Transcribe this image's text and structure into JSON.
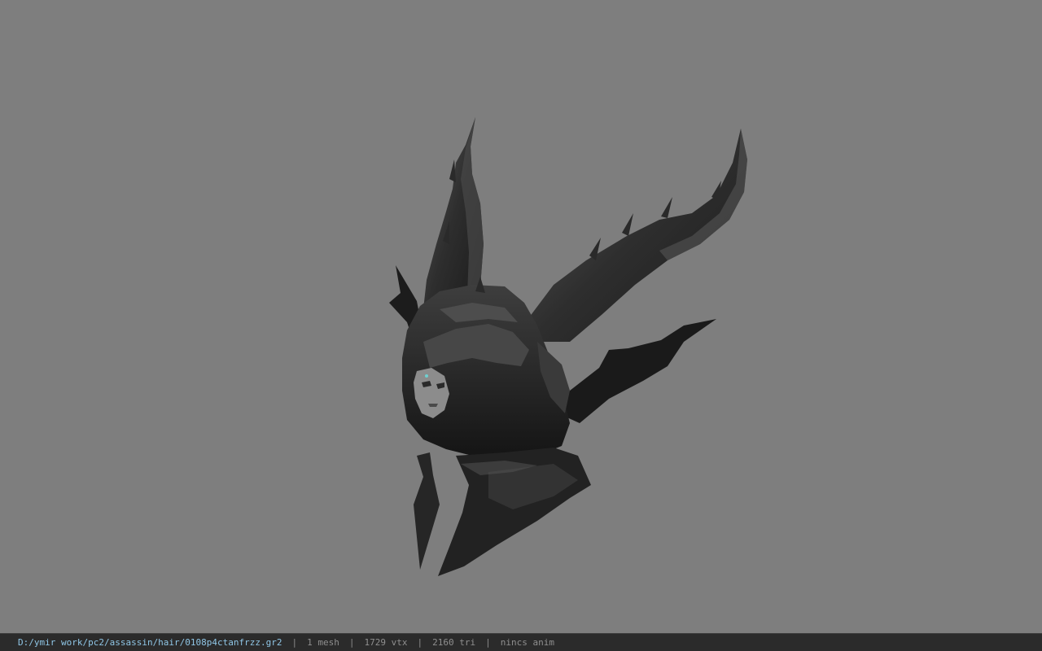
{
  "status_bar": {
    "file_path": "D:/ymir work/pc2/assassin/hair/0108p4ctanfrzz.gr2",
    "separator": "|",
    "mesh_count": "1 mesh",
    "vertex_count": "1729 vtx",
    "triangle_count": "2160 tri",
    "anim_status": "nincs anim"
  },
  "colors": {
    "background": "#7e7e7e",
    "status_bar_bg": "#2b2b2b",
    "path_text": "#8fc6e6",
    "status_text": "#8f8f8f"
  },
  "viewport": {
    "model_icon": "horned-helmet-model"
  }
}
